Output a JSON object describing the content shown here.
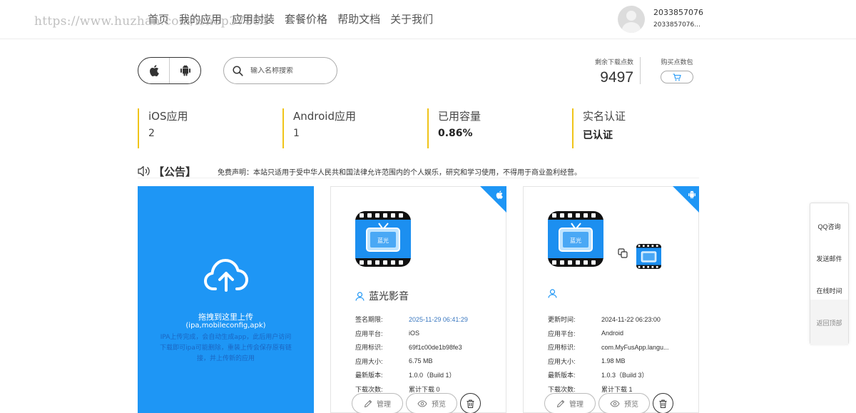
{
  "watermark": "https://www.huzhan.com/ishop37804",
  "nav": {
    "items": [
      "首页",
      "我的应用",
      "应用封装",
      "套餐价格",
      "帮助文档",
      "关于我们"
    ]
  },
  "user": {
    "id": "2033857076",
    "sub": "2033857076..."
  },
  "toolbar": {
    "search_placeholder": "输入名称搜索",
    "points_label": "剩余下载点数",
    "points_value": "9497",
    "buy_label": "购买点数包"
  },
  "stats": [
    {
      "label": "iOS应用",
      "value": "2"
    },
    {
      "label": "Android应用",
      "value": "1"
    },
    {
      "label": "已用容量",
      "value": "0.86%"
    },
    {
      "label": "实名认证",
      "value": "已认证"
    }
  ],
  "announcement": {
    "title": "【公告】",
    "text": "免费声明：本站只适用于受中华人民共和国法律允许范围内的个人娱乐，研究和学习使用，不得用于商业盈利经营。"
  },
  "upload": {
    "title": "拖拽到这里上传",
    "types": "(ipa,mobileconfig,apk)",
    "desc": "IPA上传完成，会自动生成app，此后用户访问下载即可ipa可能删除，重装上传会保存原有链接，并上传新的应用"
  },
  "apps": [
    {
      "name": "蓝光影音",
      "icon_text": "蓝光",
      "rows": [
        {
          "label": "签名期限:",
          "value": "2025-11-29 06:41:29"
        },
        {
          "label": "应用平台:",
          "value": "iOS"
        },
        {
          "label": "应用标识:",
          "value": "69f1c00de1b98fe3"
        },
        {
          "label": "应用大小:",
          "value": "6.75 MB"
        },
        {
          "label": "最新版本:",
          "value": "1.0.0（Build 1）"
        },
        {
          "label": "下载次数:",
          "value": "累计下载 0"
        }
      ],
      "manage_label": "管理",
      "preview_label": "预览"
    },
    {
      "name": "",
      "icon_text": "蓝光",
      "rows": [
        {
          "label": "更新时间:",
          "value": "2024-11-22 06:23:00"
        },
        {
          "label": "应用平台:",
          "value": "Android"
        },
        {
          "label": "应用标识:",
          "value": "com.MyFusApp.langu..."
        },
        {
          "label": "应用大小:",
          "value": "1.98 MB"
        },
        {
          "label": "最新版本:",
          "value": "1.0.3（Build 3）"
        },
        {
          "label": "下载次数:",
          "value": "累计下载 1"
        }
      ],
      "manage_label": "管理",
      "preview_label": "预览"
    }
  ],
  "float": {
    "items": [
      "QQ咨询",
      "发送邮件",
      "在线时间",
      "返回顶部"
    ]
  },
  "colors": {
    "accent": "#1e96f5",
    "stat_border": "#f0c419"
  }
}
